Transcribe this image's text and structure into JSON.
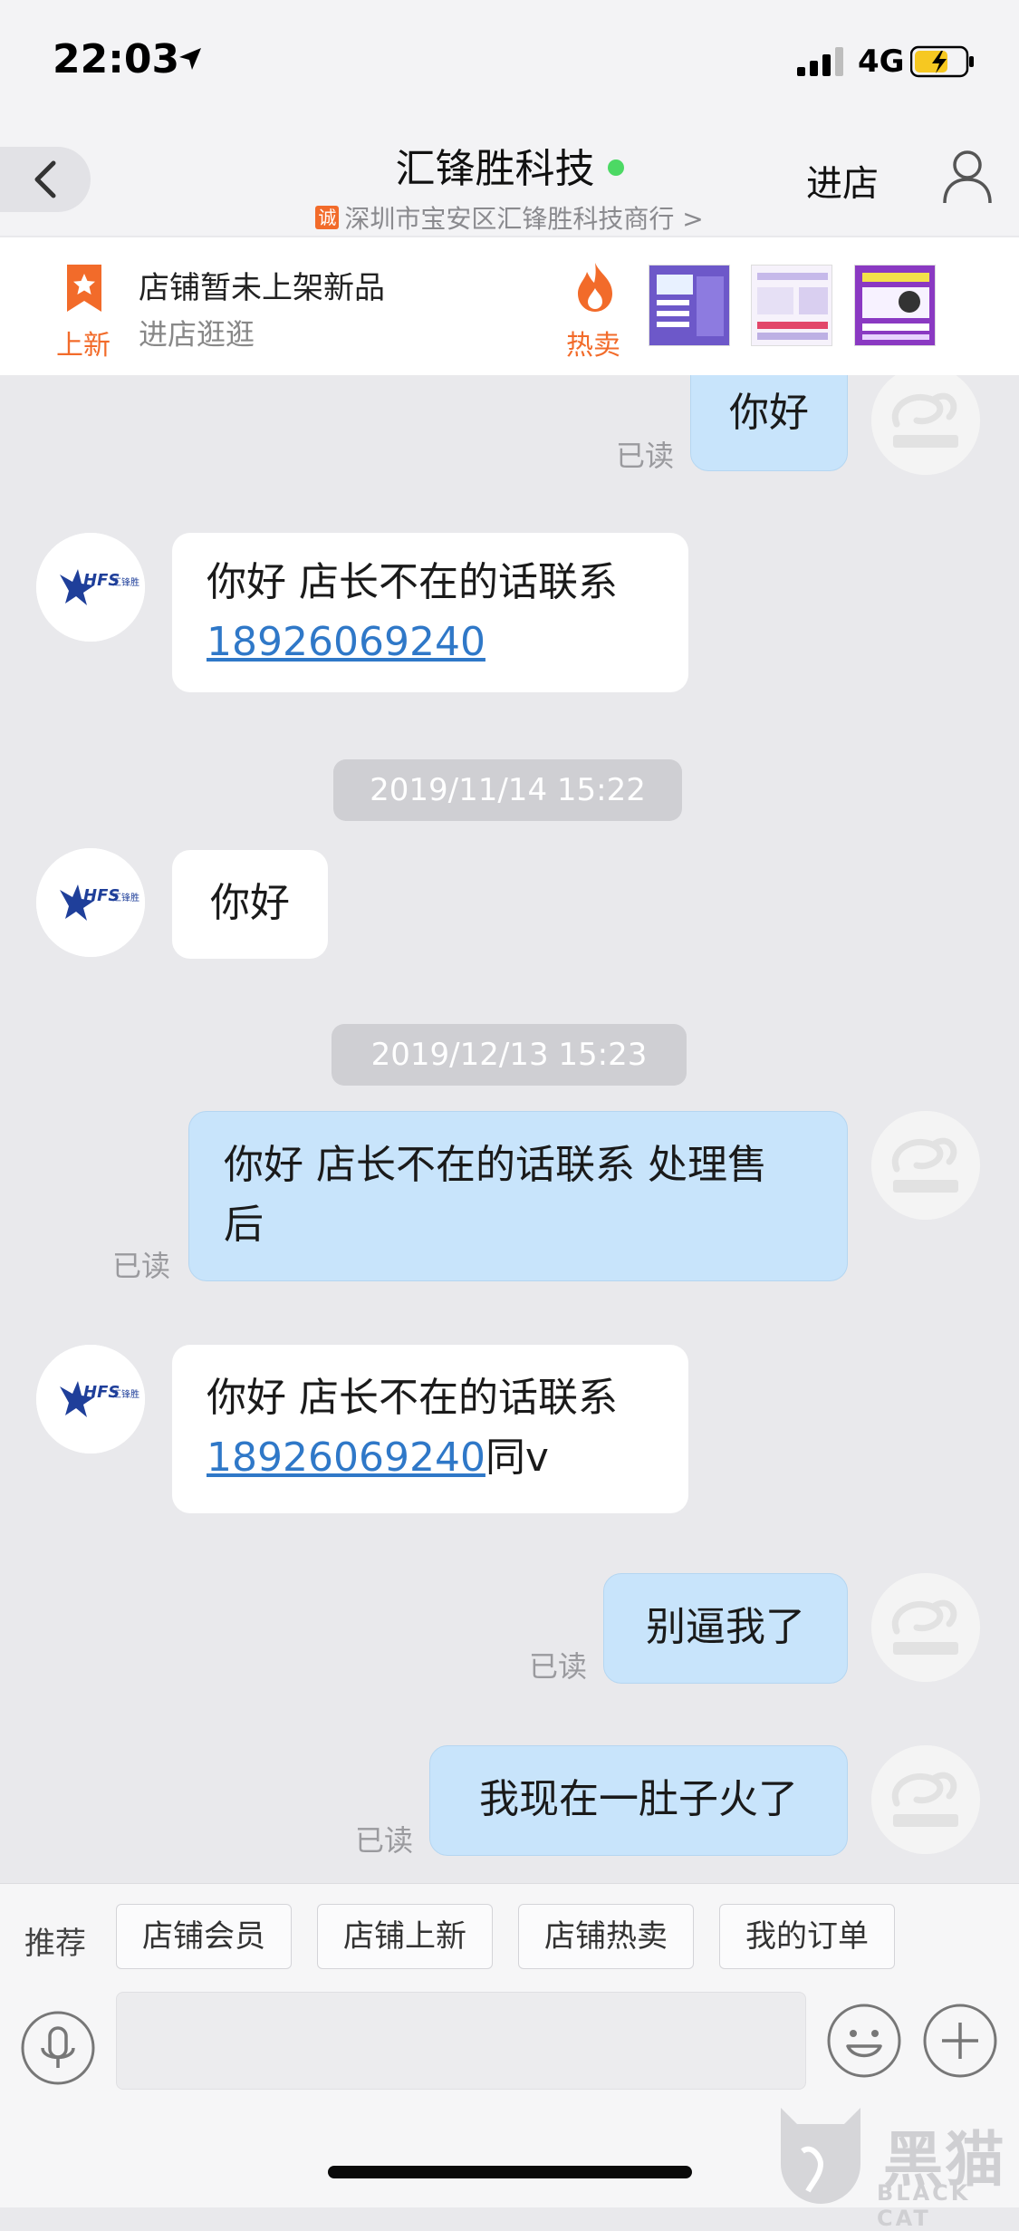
{
  "status_bar": {
    "time": "22:03",
    "network": "4G"
  },
  "header": {
    "title": "汇锋胜科技",
    "subtitle": "深圳市宝安区汇锋胜科技商行 >",
    "trust_badge": "诚",
    "enter_store": "进店"
  },
  "shop_bar": {
    "new_label": "上新",
    "no_new_text": "店铺暂未上架新品",
    "browse_text": "进店逛逛",
    "hot_label": "热卖"
  },
  "chat": {
    "messages": [
      {
        "side": "out",
        "text": "你好",
        "status": "已读"
      },
      {
        "side": "in",
        "text": "你好 店长不在的话联系",
        "phone": "18926069240",
        "suffix": ""
      },
      {
        "type": "time",
        "text": "2019/11/14 15:22"
      },
      {
        "side": "in",
        "text": "你好"
      },
      {
        "type": "time",
        "text": "2019/12/13 15:23"
      },
      {
        "side": "out",
        "text_line1": "你好 店长不在的话联系 处理售",
        "text_line2": "后",
        "status": "已读"
      },
      {
        "side": "in",
        "text": "你好 店长不在的话联系",
        "phone": "18926069240",
        "suffix": "同v"
      },
      {
        "side": "out",
        "text": "别逼我了",
        "status": "已读"
      },
      {
        "side": "out",
        "text": "我现在一肚子火了",
        "status": "已读"
      }
    ]
  },
  "quick_bar": {
    "label": "推荐",
    "buttons": [
      "店铺会员",
      "店铺上新",
      "店铺热卖",
      "我的订单"
    ]
  },
  "input": {
    "placeholder": ""
  },
  "watermark": {
    "text": "黑猫",
    "sub": "BLACK CAT"
  },
  "colors": {
    "accent_orange": "#f26b2a",
    "bubble_out": "#c8e4fb",
    "link_blue": "#2f78c8",
    "online_green": "#4cd964"
  }
}
